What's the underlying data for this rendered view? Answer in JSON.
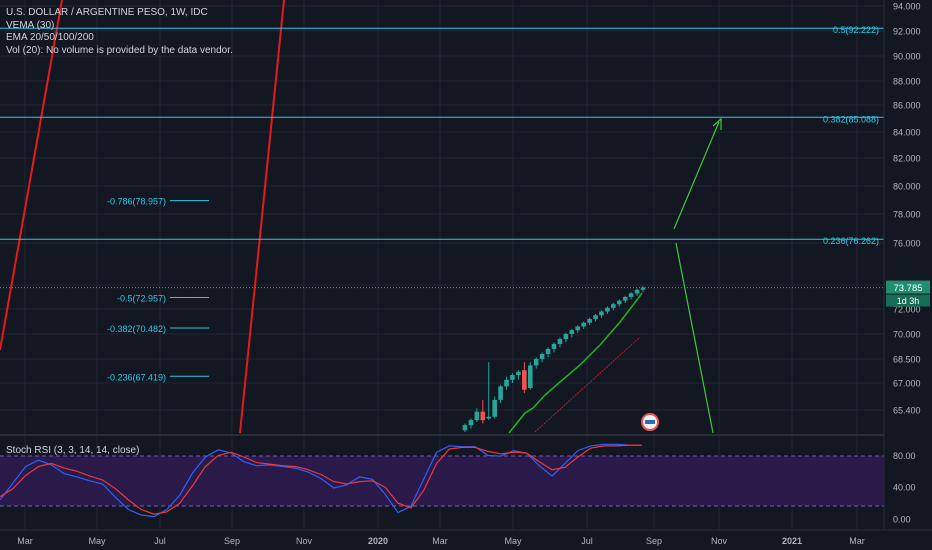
{
  "legend": {
    "symbol": "U.S. DOLLAR / ARGENTINE PESO, 1W, IDC",
    "indicators": [
      "VEMA (30)",
      "EMA 20/50/100/200",
      "Vol (20): No volume is provided by the data vendor."
    ]
  },
  "rsi_panel": {
    "title": "Stoch RSI (3, 3, 14, 14, close)",
    "ticks": [
      "80.00",
      "40.00",
      "0.00"
    ],
    "background": "#2a1a4a"
  },
  "colors": {
    "background": "#131722",
    "axis_text": "#b2b5be",
    "fib": "#2ec8e8",
    "candle": "#26a69a",
    "price_badge": "#1e8f6e",
    "ema": "#21b521",
    "red": "#e51a1a",
    "arrow": "#3ec93e",
    "rsi_k": "#2962ff",
    "rsi_d": "#f2363a"
  },
  "chart_data": {
    "type": "candlestick",
    "price_axis": {
      "ticks": [
        "94.000",
        "92.000",
        "90.000",
        "88.000",
        "86.000",
        "84.000",
        "82.000",
        "80.000",
        "78.000",
        "76.000",
        "74.000",
        "72.000",
        "70.000",
        "68.500",
        "67.000",
        "65.400"
      ]
    },
    "time_axis": {
      "ticks": [
        "Mar",
        "May",
        "Jul",
        "Sep",
        "Nov",
        "2020",
        "Mar",
        "May",
        "Jul",
        "Sep",
        "Nov",
        "2021",
        "Mar"
      ]
    },
    "current_price": "73.785",
    "countdown": "1d 3h",
    "fib_lines_full": [
      {
        "label": "0.5(92.222)",
        "value": 92.222
      },
      {
        "label": "0.382(85.088)",
        "value": 85.088
      },
      {
        "label": "0.236(76.262)",
        "value": 76.262
      }
    ],
    "fib_lines_short": [
      {
        "label": "-0.786(78.957)",
        "value": 78.957
      },
      {
        "label": "-0.5(72.957)",
        "value": 72.957
      },
      {
        "label": "-0.382(70.482)",
        "value": 70.482
      },
      {
        "label": "-0.236(67.419)",
        "value": 67.419
      }
    ],
    "candles": [
      [
        64.2,
        64.6,
        64.1,
        64.5
      ],
      [
        64.5,
        64.9,
        64.3,
        64.8
      ],
      [
        64.8,
        65.5,
        64.7,
        65.3
      ],
      [
        65.3,
        66.0,
        64.6,
        64.8
      ],
      [
        64.9,
        68.3,
        64.8,
        65.0
      ],
      [
        65.0,
        66.2,
        64.9,
        66.0
      ],
      [
        66.0,
        66.9,
        65.8,
        66.8
      ],
      [
        66.8,
        67.4,
        66.6,
        67.2
      ],
      [
        67.2,
        67.6,
        67.0,
        67.5
      ],
      [
        67.5,
        67.8,
        67.2,
        67.7
      ],
      [
        67.8,
        68.3,
        66.4,
        66.6
      ],
      [
        66.7,
        68.3,
        66.6,
        68.1
      ],
      [
        68.1,
        68.6,
        67.9,
        68.5
      ],
      [
        68.5,
        68.9,
        68.3,
        68.8
      ],
      [
        68.8,
        69.2,
        68.6,
        69.1
      ],
      [
        69.1,
        69.5,
        68.9,
        69.4
      ],
      [
        69.4,
        69.8,
        69.2,
        69.7
      ],
      [
        69.7,
        70.1,
        69.5,
        70.0
      ],
      [
        70.0,
        70.4,
        69.8,
        70.3
      ],
      [
        70.3,
        70.7,
        70.1,
        70.6
      ],
      [
        70.6,
        71.0,
        70.4,
        70.9
      ],
      [
        70.9,
        71.3,
        70.7,
        71.2
      ],
      [
        71.2,
        71.6,
        71.0,
        71.5
      ],
      [
        71.5,
        71.9,
        71.3,
        71.8
      ],
      [
        71.8,
        72.2,
        71.6,
        72.1
      ],
      [
        72.1,
        72.5,
        71.9,
        72.4
      ],
      [
        72.4,
        72.8,
        72.2,
        72.7
      ],
      [
        72.7,
        73.1,
        72.5,
        73.0
      ],
      [
        73.0,
        73.4,
        72.8,
        73.3
      ],
      [
        73.3,
        73.7,
        73.1,
        73.6
      ],
      [
        73.6,
        73.9,
        73.4,
        73.785
      ]
    ],
    "rsi_k": [
      24,
      45,
      66,
      74,
      68,
      57,
      53,
      48,
      44,
      27,
      12,
      5,
      3,
      12,
      30,
      58,
      78,
      87,
      83,
      72,
      67,
      68,
      66,
      64,
      59,
      51,
      39,
      43,
      53,
      50,
      31,
      8,
      16,
      50,
      84,
      92,
      91,
      91,
      80,
      79,
      86,
      83,
      67,
      54,
      70,
      86,
      92,
      94,
      94,
      93,
      93
    ],
    "rsi_d": [
      28,
      38,
      55,
      66,
      70,
      64,
      60,
      54,
      49,
      38,
      24,
      12,
      6,
      9,
      20,
      42,
      66,
      80,
      84,
      78,
      71,
      69,
      67,
      66,
      62,
      56,
      47,
      44,
      47,
      48,
      40,
      20,
      14,
      36,
      70,
      88,
      90,
      90,
      85,
      82,
      84,
      83,
      72,
      62,
      65,
      78,
      89,
      92,
      92,
      93,
      93
    ]
  }
}
